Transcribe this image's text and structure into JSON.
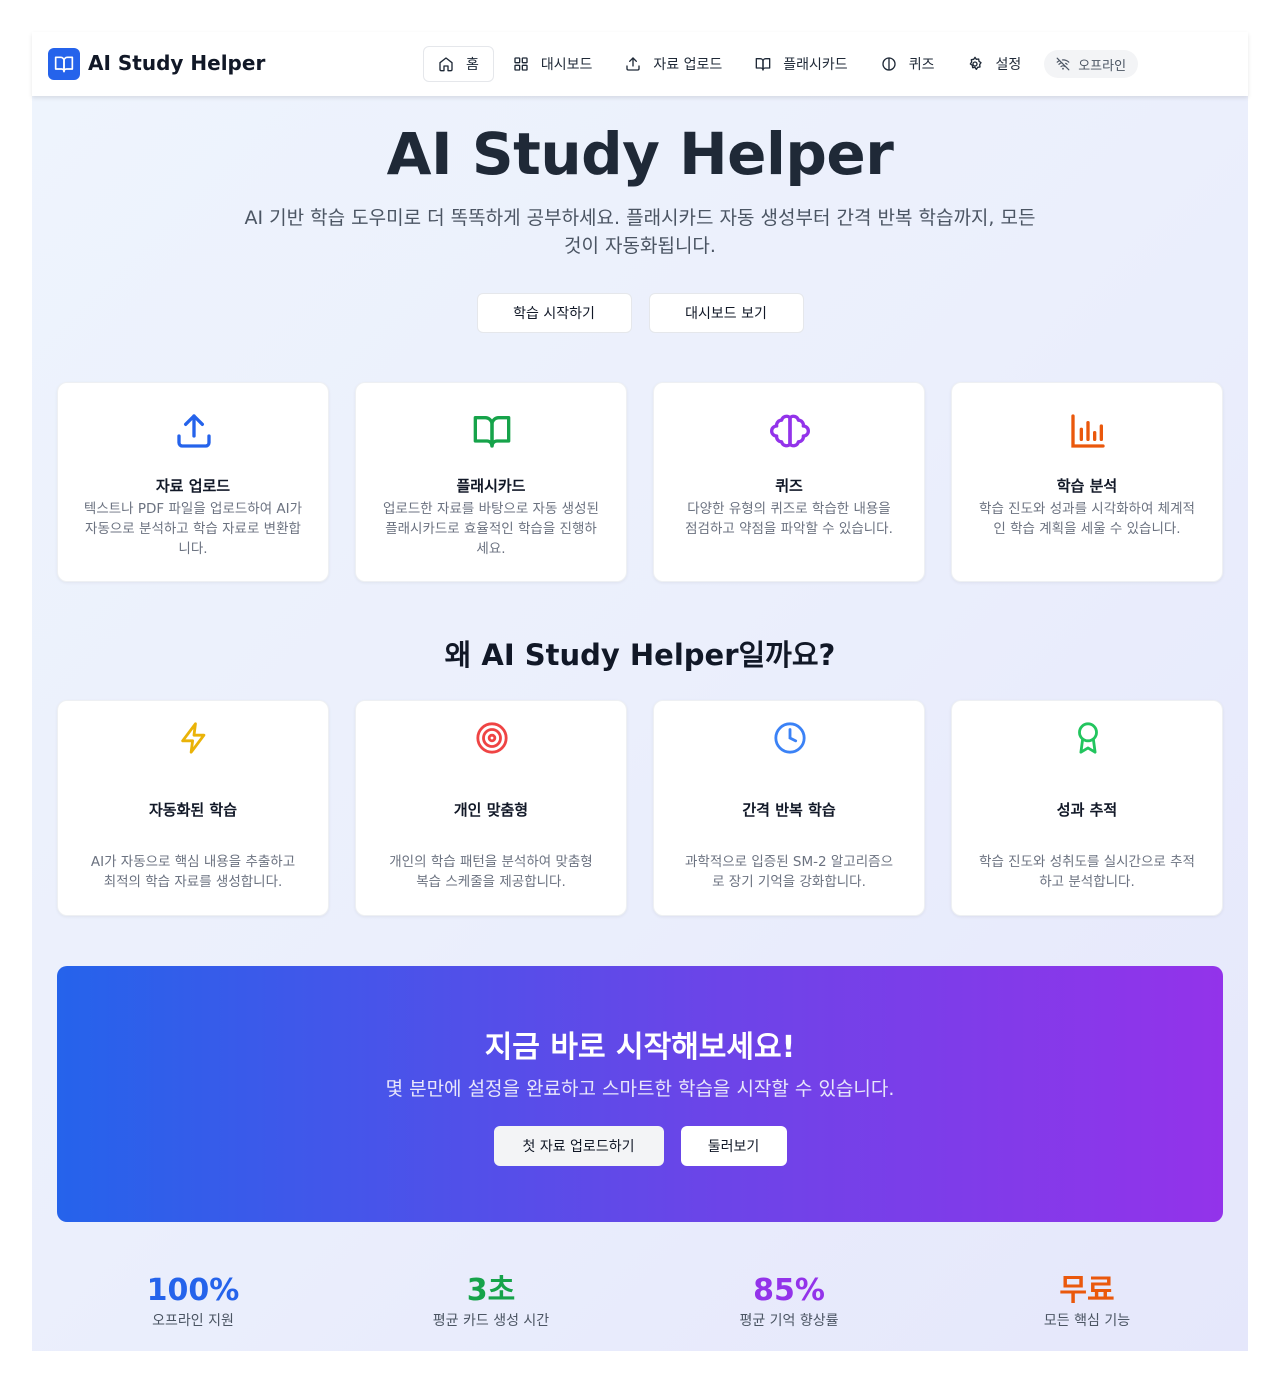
{
  "header": {
    "brand": "AI Study Helper",
    "nav": [
      {
        "label": "홈",
        "icon": "home-icon",
        "active": true
      },
      {
        "label": "대시보드",
        "icon": "grid-icon"
      },
      {
        "label": "자료 업로드",
        "icon": "upload-icon"
      },
      {
        "label": "플래시카드",
        "icon": "book-icon"
      },
      {
        "label": "퀴즈",
        "icon": "brain-icon"
      },
      {
        "label": "설정",
        "icon": "gear-icon"
      }
    ],
    "status": "오프라인"
  },
  "hero": {
    "title": "AI Study Helper",
    "subtitle": "AI 기반 학습 도우미로 더 똑똑하게 공부하세요. 플래시카드 자동 생성부터 간격 반복 학습까지, 모든 것이 자동화됩니다.",
    "primary_button": "학습 시작하기",
    "secondary_button": "대시보드 보기"
  },
  "features": [
    {
      "title": "자료 업로드",
      "desc": "텍스트나 PDF 파일을 업로드하여 AI가 자동으로 분석하고 학습 자료로 변환합니다.",
      "icon": "upload-icon",
      "color": "#2563eb"
    },
    {
      "title": "플래시카드",
      "desc": "업로드한 자료를 바탕으로 자동 생성된 플래시카드로 효율적인 학습을 진행하세요.",
      "icon": "book-open-icon",
      "color": "#16a34a"
    },
    {
      "title": "퀴즈",
      "desc": "다양한 유형의 퀴즈로 학습한 내용을 점검하고 약점을 파악할 수 있습니다.",
      "icon": "brain-icon",
      "color": "#9333ea"
    },
    {
      "title": "학습 분석",
      "desc": "학습 진도와 성과를 시각화하여 체계적인 학습 계획을 세울 수 있습니다.",
      "icon": "bar-chart-icon",
      "color": "#ea580c"
    }
  ],
  "why": {
    "title": "왜 AI Study Helper일까요?",
    "items": [
      {
        "title": "자동화된 학습",
        "desc": "AI가 자동으로 핵심 내용을 추출하고 최적의 학습 자료를 생성합니다.",
        "icon": "lightning-icon",
        "color": "#eab308"
      },
      {
        "title": "개인 맞춤형",
        "desc": "개인의 학습 패턴을 분석하여 맞춤형 복습 스케줄을 제공합니다.",
        "icon": "target-icon",
        "color": "#ef4444"
      },
      {
        "title": "간격 반복 학습",
        "desc": "과학적으로 입증된 SM-2 알고리즘으로 장기 기억을 강화합니다.",
        "icon": "clock-icon",
        "color": "#3b82f6"
      },
      {
        "title": "성과 추적",
        "desc": "학습 진도와 성취도를 실시간으로 추적하고 분석합니다.",
        "icon": "award-icon",
        "color": "#22c55e"
      }
    ]
  },
  "cta": {
    "title": "지금 바로 시작해보세요!",
    "subtitle": "몇 분만에 설정을 완료하고 스마트한 학습을 시작할 수 있습니다.",
    "primary_button": "첫 자료 업로드하기",
    "secondary_button": "둘러보기"
  },
  "stats": [
    {
      "value": "100%",
      "label": "오프라인 지원",
      "color": "#2563eb"
    },
    {
      "value": "3초",
      "label": "평균 카드 생성 시간",
      "color": "#16a34a"
    },
    {
      "value": "85%",
      "label": "평균 기억 향상률",
      "color": "#9333ea"
    },
    {
      "value": "무료",
      "label": "모든 핵심 기능",
      "color": "#ea580c"
    }
  ]
}
